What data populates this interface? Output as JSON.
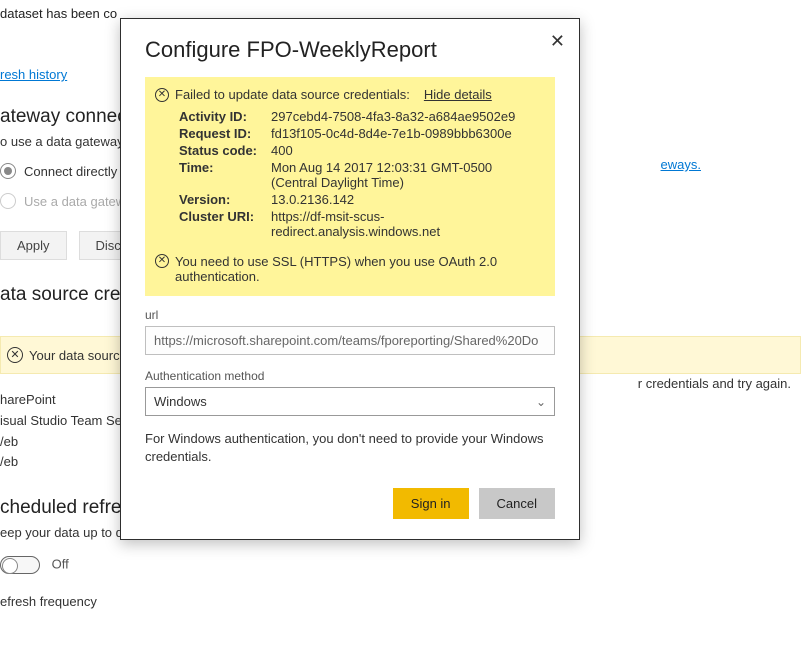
{
  "background": {
    "dataset_note": "dataset has been co",
    "refresh_history_link": "resh history",
    "gateway_heading": "ateway connecti",
    "gateway_sub": "o use a data gateway.",
    "gateways_link": "eways.",
    "radio_connect": "Connect directly",
    "radio_use_gw": "Use a data gatew",
    "apply_btn": "Apply",
    "discard_btn": "Disca",
    "datasource_creds_heading": "ata source crede",
    "error_banner_text": "Your data sourc",
    "error_banner_right": "r credentials and try again.",
    "sources": [
      "harePoint",
      "isual Studio Team Ser",
      "/eb",
      "/eb"
    ],
    "scheduled_heading": "cheduled refresh",
    "keep_data": "eep your data up to d",
    "toggle_label": "Off",
    "refresh_freq": "efresh frequency"
  },
  "dialog": {
    "title": "Configure FPO-WeeklyReport",
    "fail_message": "Failed to update data source credentials:",
    "hide_details": "Hide details",
    "rows": {
      "activity_id_k": "Activity ID:",
      "activity_id_v": "297cebd4-7508-4fa3-8a32-a684ae9502e9",
      "request_id_k": "Request ID:",
      "request_id_v": "fd13f105-0c4d-8d4e-7e1b-0989bbb6300e",
      "status_k": "Status code:",
      "status_v": "400",
      "time_k": "Time:",
      "time_v": "Mon Aug 14 2017 12:03:31 GMT-0500 (Central Daylight Time)",
      "version_k": "Version:",
      "version_v": "13.0.2136.142",
      "cluster_k": "Cluster URI:",
      "cluster_v": "https://df-msit-scus-redirect.analysis.windows.net"
    },
    "ssl_msg": "You need to use SSL (HTTPS) when you use OAuth 2.0 authentication.",
    "url_label": "url",
    "url_value": "https://microsoft.sharepoint.com/teams/fporeporting/Shared%20Do",
    "auth_label": "Authentication method",
    "auth_value": "Windows",
    "help_text": "For Windows authentication, you don't need to provide your Windows credentials.",
    "signin_btn": "Sign in",
    "cancel_btn": "Cancel"
  }
}
